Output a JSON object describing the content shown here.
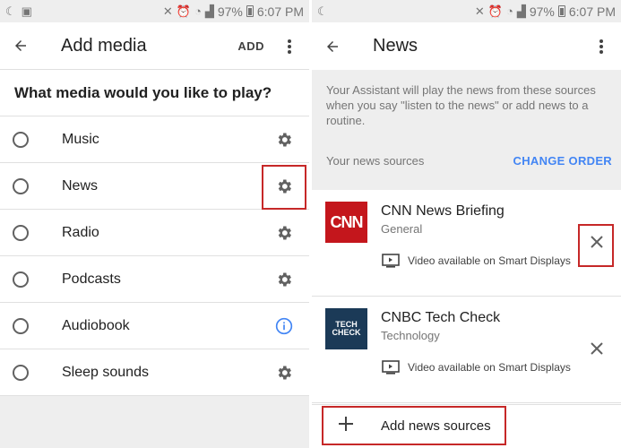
{
  "status_bar": {
    "battery": "97%",
    "time": "6:07 PM"
  },
  "left_screen": {
    "title": "Add media",
    "add_action": "ADD",
    "question": "What media would you like to play?",
    "items": [
      {
        "label": "Music",
        "action_icon": "gear-icon"
      },
      {
        "label": "News",
        "action_icon": "gear-icon",
        "highlighted": true
      },
      {
        "label": "Radio",
        "action_icon": "gear-icon"
      },
      {
        "label": "Podcasts",
        "action_icon": "gear-icon"
      },
      {
        "label": "Audiobook",
        "action_icon": "info-icon"
      },
      {
        "label": "Sleep sounds",
        "action_icon": "gear-icon"
      }
    ]
  },
  "right_screen": {
    "title": "News",
    "info_text": "Your Assistant will play the news from these sources when you say \"listen to the news\" or add news to a routine.",
    "sources_label": "Your news sources",
    "change_order": "CHANGE ORDER",
    "sources": [
      {
        "name": "CNN News Briefing",
        "category": "General",
        "logo_text": "CNN",
        "video_note": "Video available on Smart Displays",
        "highlighted": true
      },
      {
        "name": "CNBC Tech Check",
        "category": "Technology",
        "logo_text": "TECH CHECK",
        "video_note": "Video available on Smart Displays",
        "highlighted": false
      }
    ],
    "add_sources_label": "Add news sources"
  },
  "colors": {
    "accent": "#4285f4",
    "highlight": "#c62828",
    "cnn_red": "#c4161c",
    "cnbc_navy": "#1b3a57",
    "banner_bg": "#eeeeee"
  }
}
